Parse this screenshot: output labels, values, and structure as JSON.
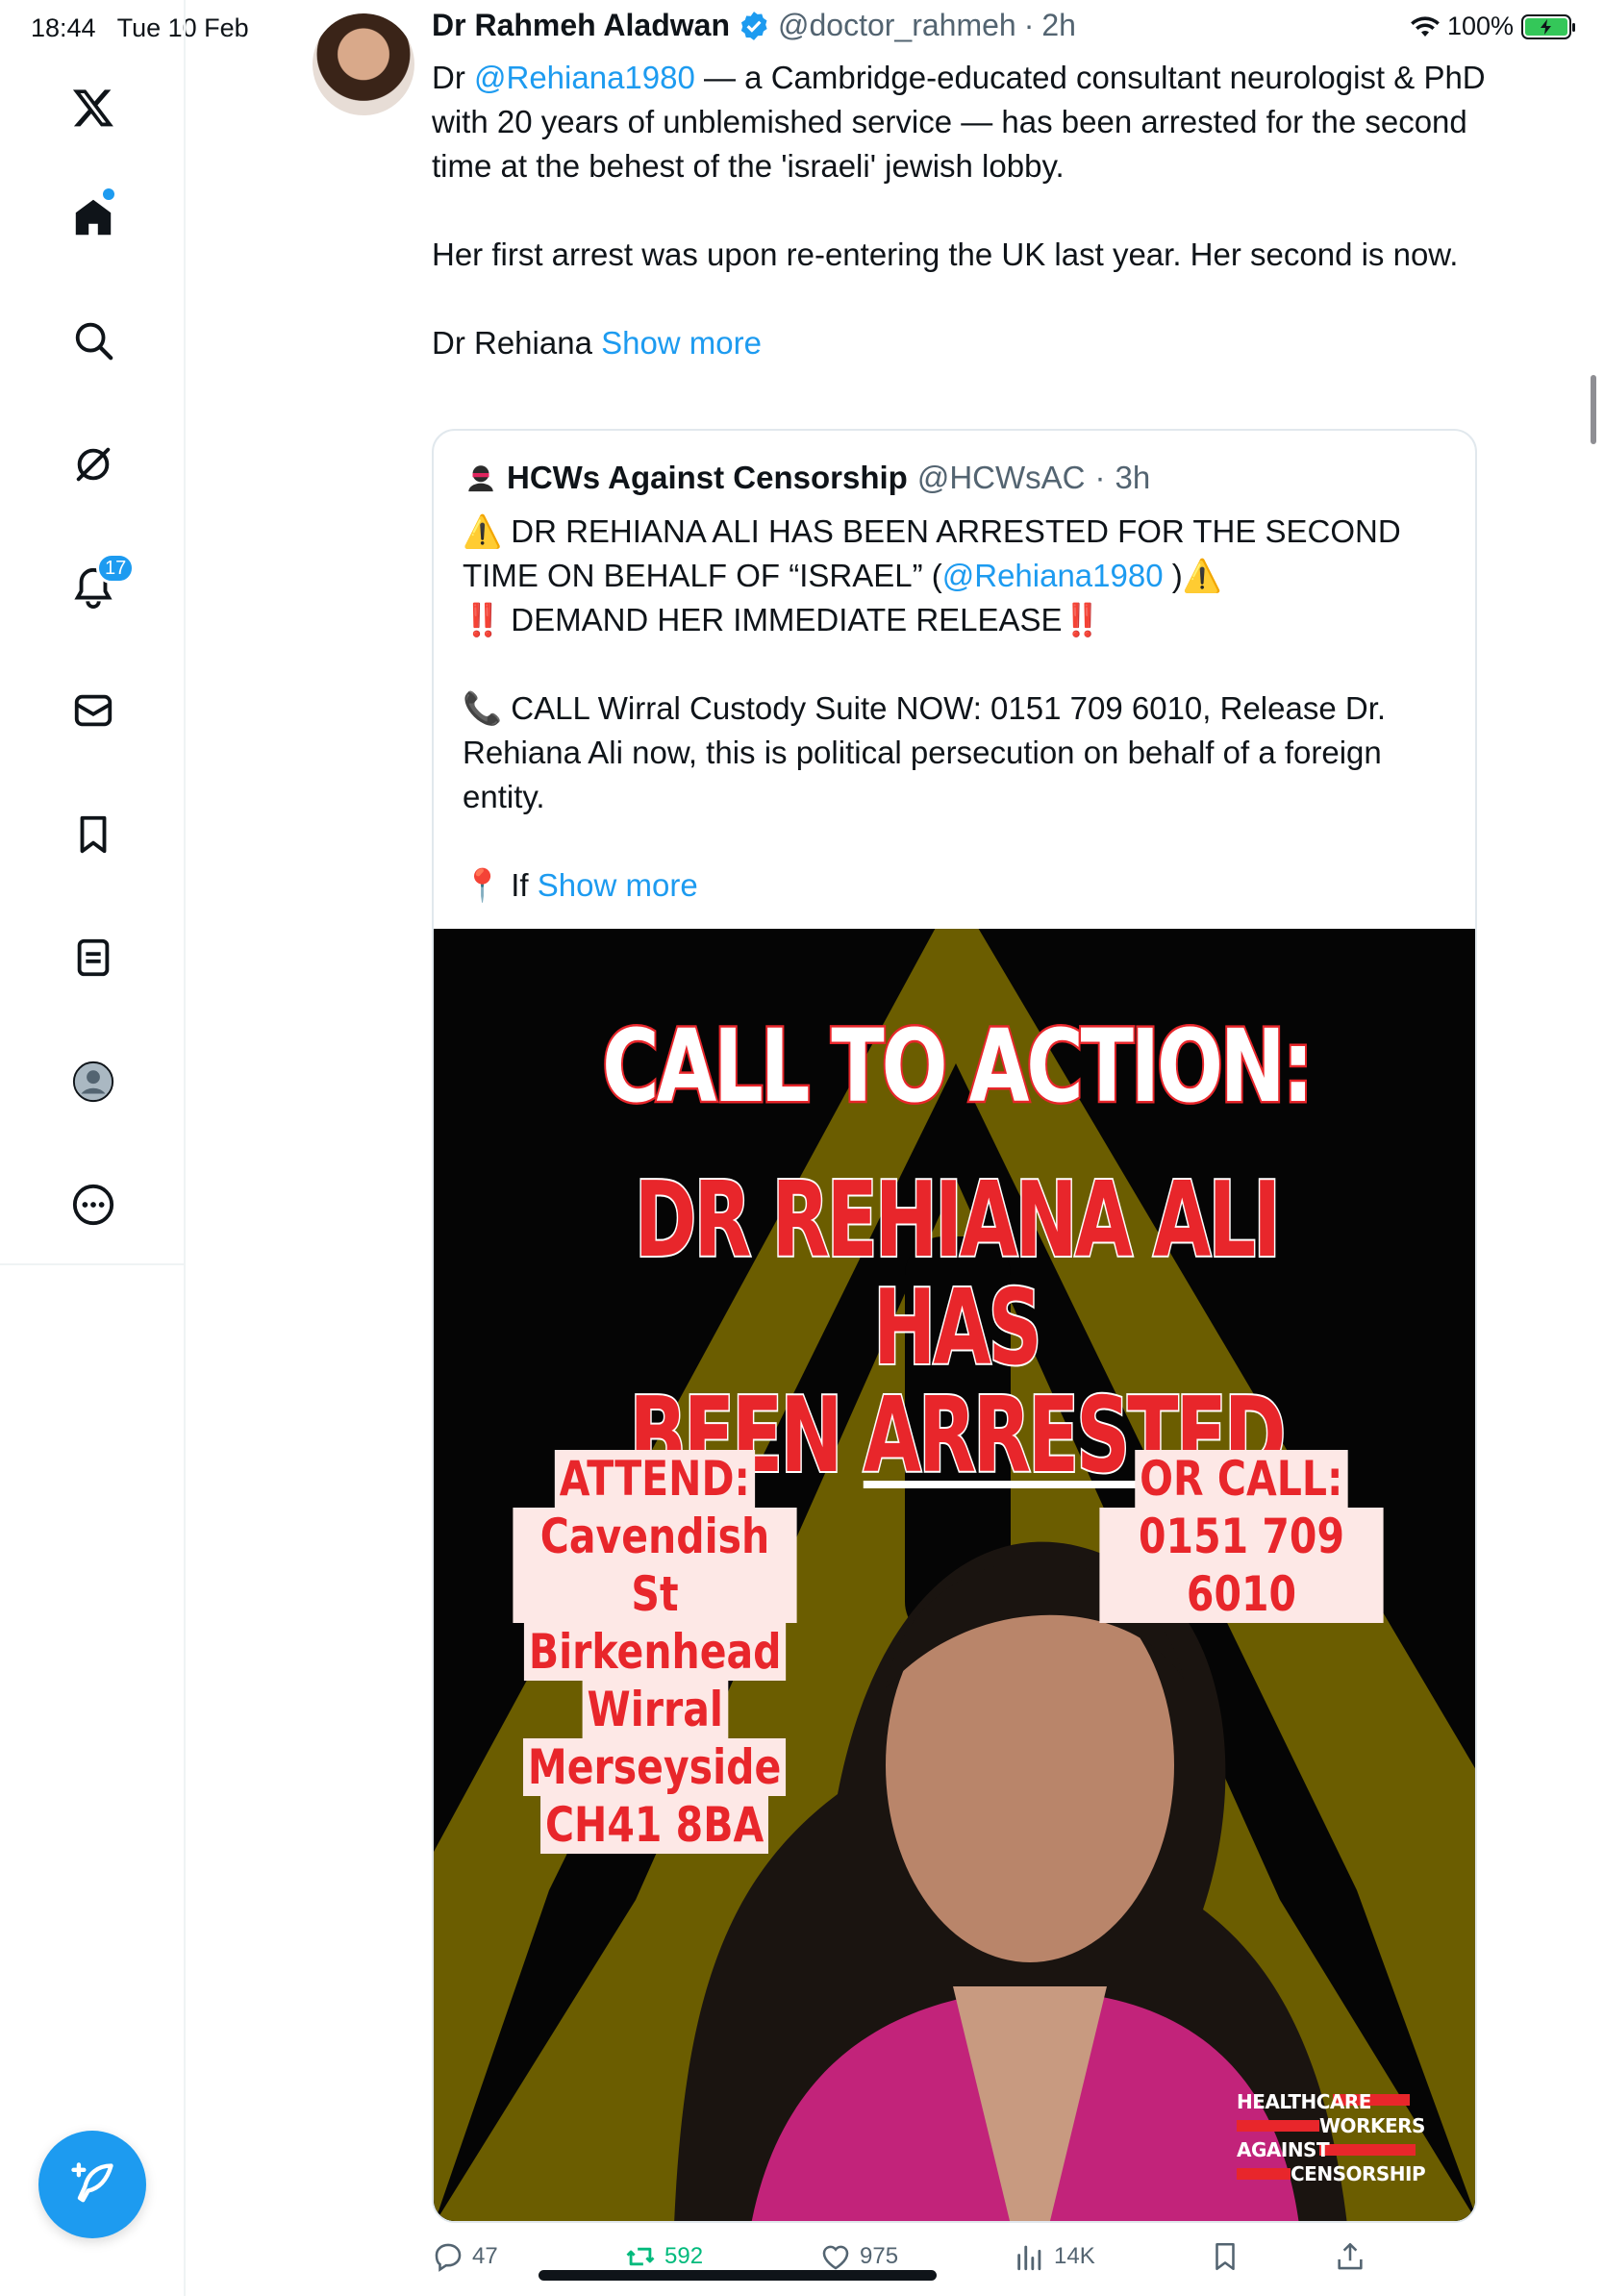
{
  "status_bar": {
    "time": "18:44",
    "date": "Tue 10 Feb",
    "battery": "100%"
  },
  "sidebar": {
    "notifications_badge": "17"
  },
  "tweet": {
    "author": "Dr Rahmeh Aladwan",
    "handle": "@doctor_rahmeh",
    "separator": "·",
    "time": "2h",
    "text_prefix": "Dr ",
    "mention": "@Rehiana1980",
    "text_line1": " — a Cambridge-educated consultant neurologist & PhD with 20 years of unblemished service — has been arrested for the second time at the behest of the 'israeli' jewish lobby.",
    "paragraph2": "Her first arrest was upon re-entering the UK last year. Her second is now.",
    "truncated": "Dr Rehiana ",
    "show_more": "Show more"
  },
  "quoted": {
    "author": "HCWs Against Censorship",
    "handle": "@HCWsAC",
    "separator": "·",
    "time": "3h",
    "line1": "⚠️ DR REHIANA ALI HAS BEEN ARRESTED FOR THE SECOND TIME ON BEHALF OF “ISRAEL” (",
    "mention": "@Rehiana1980",
    "line1_end": " )⚠️",
    "line2_prefix": "‼️",
    "line2": " DEMAND HER IMMEDIATE RELEASE",
    "line2_suffix": "‼️",
    "line3": "📞 CALL Wirral Custody Suite NOW: 0151 709 6010, Release Dr. Rehiana Ali now, this is political persecution on behalf of a foreign entity.",
    "truncated": "📍 If ",
    "show_more": "Show more"
  },
  "poster": {
    "title": "CALL TO ACTION:",
    "sub_line1": "DR REHIANA ALI HAS",
    "sub_line2_a": "BEEN ",
    "sub_line2_b": "ARRESTED",
    "attend": [
      "ATTEND:",
      "Cavendish St",
      "Birkenhead",
      "Wirral",
      "Merseyside",
      "CH41 8BA"
    ],
    "call": [
      "OR CALL:",
      "0151 709 6010"
    ],
    "brand": [
      "HEALTHCARE",
      "WORKERS",
      "AGAINST",
      "CENSORSHIP"
    ],
    "colors": {
      "red": "#e8262b",
      "olive": "#6b5d00",
      "black": "#050505"
    }
  },
  "actions": {
    "replies": "47",
    "reposts": "592",
    "likes": "975",
    "views": "14K"
  },
  "colors": {
    "accent": "#1d9bf0",
    "text": "#0f1419",
    "muted": "#536471",
    "repost_green": "#00ba7c"
  }
}
